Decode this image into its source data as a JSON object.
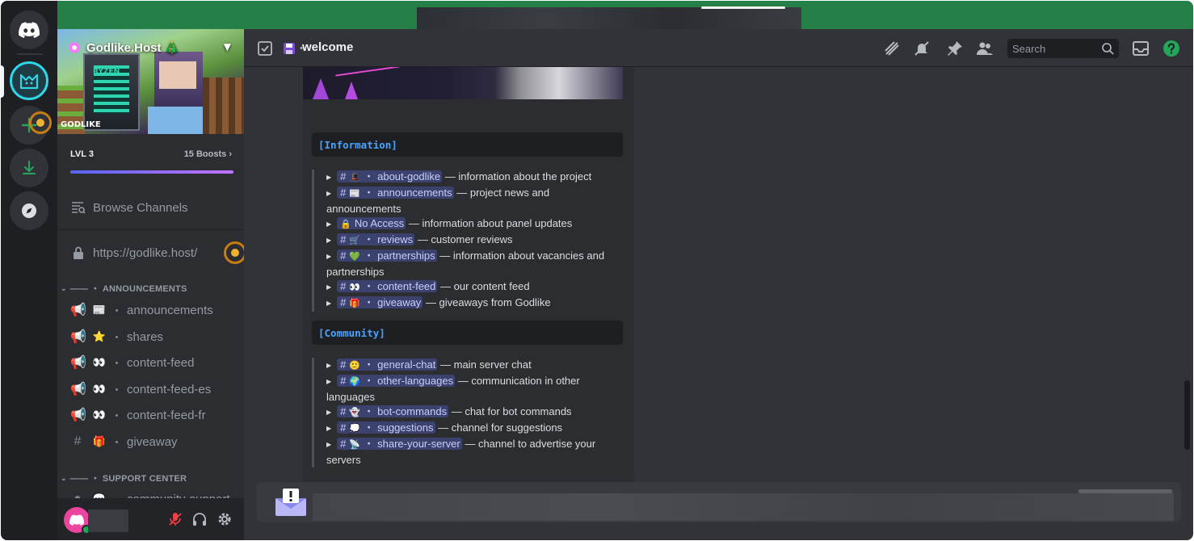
{
  "server": {
    "name": "Godlike.Host 🎄",
    "banner_logo": "GODLIKE",
    "banner_cpu_label": "RYZEN",
    "level": "LVL 3",
    "boosts": "15 Boosts",
    "boost_chevron": "›"
  },
  "sidebar": {
    "browse_channels": "Browse Channels",
    "locked_link": "https://godlike.host/",
    "categories": [
      {
        "label": "—— ・ ANNOUNCEMENTS",
        "channels": [
          {
            "kind": "announcement",
            "emoji": "📰",
            "name": "announcements"
          },
          {
            "kind": "announcement",
            "emoji": "⭐",
            "name": "shares"
          },
          {
            "kind": "announcement",
            "emoji": "👀",
            "name": "content-feed"
          },
          {
            "kind": "announcement",
            "emoji": "👀",
            "name": "content-feed-es"
          },
          {
            "kind": "announcement",
            "emoji": "👀",
            "name": "content-feed-fr"
          },
          {
            "kind": "text",
            "emoji": "🎁",
            "name": "giveaway"
          }
        ]
      },
      {
        "label": "—— ・ SUPPORT CENTER",
        "channels": [
          {
            "kind": "text",
            "emoji": "💬",
            "name": "community-support"
          }
        ]
      }
    ]
  },
  "header": {
    "channel_name": "welcome",
    "search_placeholder": "Search"
  },
  "content": {
    "sections": [
      {
        "title": "[Information]",
        "lines": [
          {
            "emoji": "🎩",
            "channel": "about-godlike",
            "desc": "— information about the project"
          },
          {
            "emoji": "📰",
            "channel": "announcements",
            "desc": "— project news and announcements"
          },
          {
            "emoji": "🔒",
            "channel": "No Access",
            "desc": "— information about panel updates",
            "locked": true
          },
          {
            "emoji": "🛒",
            "channel": "reviews",
            "desc": "— customer reviews"
          },
          {
            "emoji": "💚",
            "channel": "partnerships",
            "desc": "— information about vacancies and partnerships"
          },
          {
            "emoji": "👀",
            "channel": "content-feed",
            "desc": "— our content feed"
          },
          {
            "emoji": "🎁",
            "channel": "giveaway",
            "desc": "— giveaways from Godlike"
          }
        ]
      },
      {
        "title": "[Community]",
        "lines": [
          {
            "emoji": "🙂",
            "channel": "general-chat",
            "desc": "— main server chat"
          },
          {
            "emoji": "🌍",
            "channel": "other-languages",
            "desc": "— communication in other languages"
          },
          {
            "emoji": "👻",
            "channel": "bot-commands",
            "desc": "— chat for bot commands"
          },
          {
            "emoji": "💭",
            "channel": "suggestions",
            "desc": "— channel for suggestions"
          },
          {
            "emoji": "📡",
            "channel": "share-your-server",
            "desc": "— channel to advertise your servers"
          }
        ]
      }
    ]
  },
  "icons": {
    "rail": [
      "discord-home-icon",
      "godlike-server-icon",
      "add-server-icon",
      "download-icon",
      "explore-icon"
    ],
    "header": [
      "threads-icon",
      "mute-icon",
      "pin-icon",
      "members-icon",
      "search-icon",
      "inbox-icon",
      "help-icon"
    ],
    "user_panel": [
      "microphone-muted-icon",
      "headphones-icon",
      "settings-icon"
    ]
  },
  "colors": {
    "accent": "#5865f2",
    "online": "#23a55a",
    "topbar": "#248046",
    "section_title": "#4aa3ff",
    "mention_bg": "#3c4270",
    "muted_red": "#f23f43",
    "hint": "#f0b232"
  }
}
